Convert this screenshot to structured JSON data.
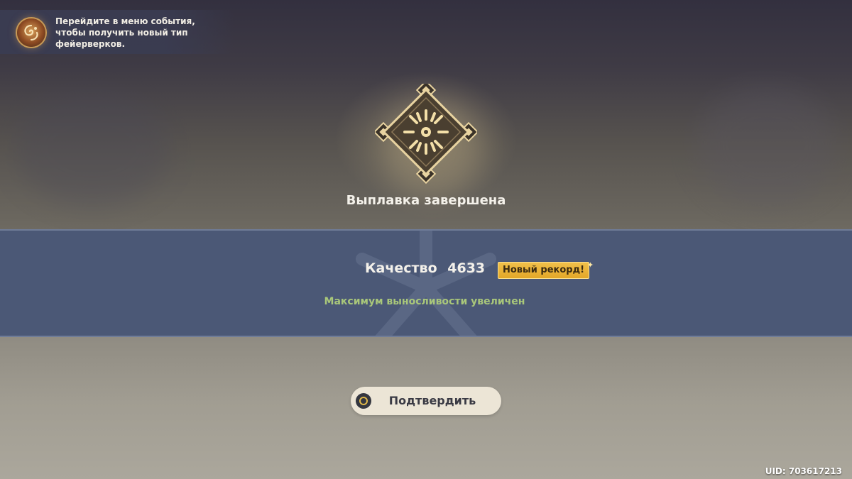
{
  "notification": {
    "line1": "Перейдите в меню события,",
    "line2": "чтобы получить новый тип",
    "line3": "фейерверков.",
    "icon": "event-fireworks-icon"
  },
  "result": {
    "title": "Выплавка завершена",
    "emblem_icon": "firework-burst-icon",
    "quality_label": "Качество",
    "quality_value": "4633",
    "record_badge": "Новый рекорд!",
    "bonus_text": "Максимум выносливости увеличен"
  },
  "confirm": {
    "label": "Подтвердить",
    "icon": "confirm-circle-icon"
  },
  "uid": "UID: 703617213",
  "colors": {
    "band": "#4b5876",
    "badge": "#f1c04a",
    "bonus": "#a9c77a",
    "button": "#ece5d6"
  }
}
